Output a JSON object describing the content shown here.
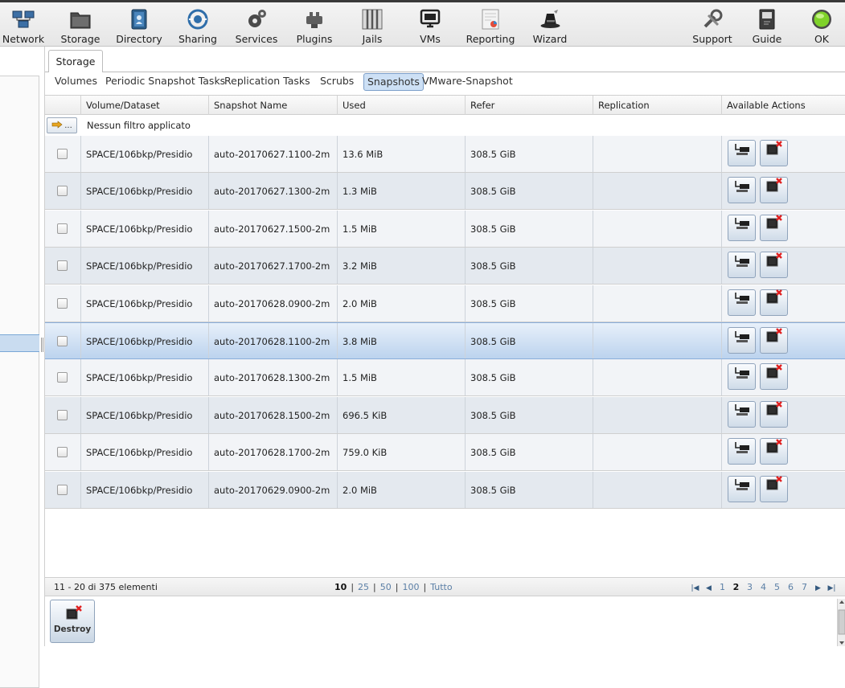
{
  "toolbar": {
    "items": [
      {
        "label": "Network",
        "icon": "network-icon"
      },
      {
        "label": "Storage",
        "icon": "folder-icon"
      },
      {
        "label": "Directory",
        "icon": "directory-icon"
      },
      {
        "label": "Sharing",
        "icon": "sharing-icon"
      },
      {
        "label": "Services",
        "icon": "gears-icon"
      },
      {
        "label": "Plugins",
        "icon": "plugin-icon"
      },
      {
        "label": "Jails",
        "icon": "jail-icon"
      },
      {
        "label": "VMs",
        "icon": "monitor-icon"
      },
      {
        "label": "Reporting",
        "icon": "report-icon"
      },
      {
        "label": "Wizard",
        "icon": "wizard-hat-icon"
      },
      {
        "label": "Support",
        "icon": "support-tools-icon"
      },
      {
        "label": "Guide",
        "icon": "guide-book-icon"
      },
      {
        "label": "OK",
        "icon": "status-ok-icon"
      }
    ]
  },
  "main": {
    "tab": "Storage",
    "subtabs": [
      "Volumes",
      "Periodic Snapshot Tasks",
      "Replication Tasks",
      "Scrubs",
      "Snapshots",
      "VMware-Snapshot"
    ],
    "active_subtab": "Snapshots"
  },
  "grid": {
    "columns": [
      "Volume/Dataset",
      "Snapshot Name",
      "Used",
      "Refer",
      "Replication",
      "Available Actions"
    ],
    "filter_button_label": "...",
    "filter_text": "Nessun filtro applicato",
    "rows": [
      {
        "dataset": "SPACE/106bkp/Presidio",
        "name": "auto-20170627.1100-2m",
        "used": "13.6 MiB",
        "refer": "308.5 GiB",
        "replication": ""
      },
      {
        "dataset": "SPACE/106bkp/Presidio",
        "name": "auto-20170627.1300-2m",
        "used": "1.3 MiB",
        "refer": "308.5 GiB",
        "replication": ""
      },
      {
        "dataset": "SPACE/106bkp/Presidio",
        "name": "auto-20170627.1500-2m",
        "used": "1.5 MiB",
        "refer": "308.5 GiB",
        "replication": ""
      },
      {
        "dataset": "SPACE/106bkp/Presidio",
        "name": "auto-20170627.1700-2m",
        "used": "3.2 MiB",
        "refer": "308.5 GiB",
        "replication": ""
      },
      {
        "dataset": "SPACE/106bkp/Presidio",
        "name": "auto-20170628.0900-2m",
        "used": "2.0 MiB",
        "refer": "308.5 GiB",
        "replication": ""
      },
      {
        "dataset": "SPACE/106bkp/Presidio",
        "name": "auto-20170628.1100-2m",
        "used": "3.8 MiB",
        "refer": "308.5 GiB",
        "replication": "",
        "selected": true
      },
      {
        "dataset": "SPACE/106bkp/Presidio",
        "name": "auto-20170628.1300-2m",
        "used": "1.5 MiB",
        "refer": "308.5 GiB",
        "replication": ""
      },
      {
        "dataset": "SPACE/106bkp/Presidio",
        "name": "auto-20170628.1500-2m",
        "used": "696.5 KiB",
        "refer": "308.5 GiB",
        "replication": ""
      },
      {
        "dataset": "SPACE/106bkp/Presidio",
        "name": "auto-20170628.1700-2m",
        "used": "759.0 KiB",
        "refer": "308.5 GiB",
        "replication": ""
      },
      {
        "dataset": "SPACE/106bkp/Presidio",
        "name": "auto-20170629.0900-2m",
        "used": "2.0 MiB",
        "refer": "308.5 GiB",
        "replication": ""
      }
    ]
  },
  "footer": {
    "range_text": "11 - 20 di 375 elementi",
    "page_sizes": [
      "10",
      "25",
      "50",
      "100",
      "Tutto"
    ],
    "current_page_size": "10",
    "pages": [
      "1",
      "2",
      "3",
      "4",
      "5",
      "6",
      "7"
    ],
    "current_page": "2"
  },
  "bottom": {
    "destroy_label": "Destroy"
  },
  "colors": {
    "selected_row": "#bcd3ee",
    "active_subtab": "#cde0f5",
    "link": "#5b7fa6",
    "delete_red": "#e02020",
    "status_ok": "#7fd22a"
  }
}
